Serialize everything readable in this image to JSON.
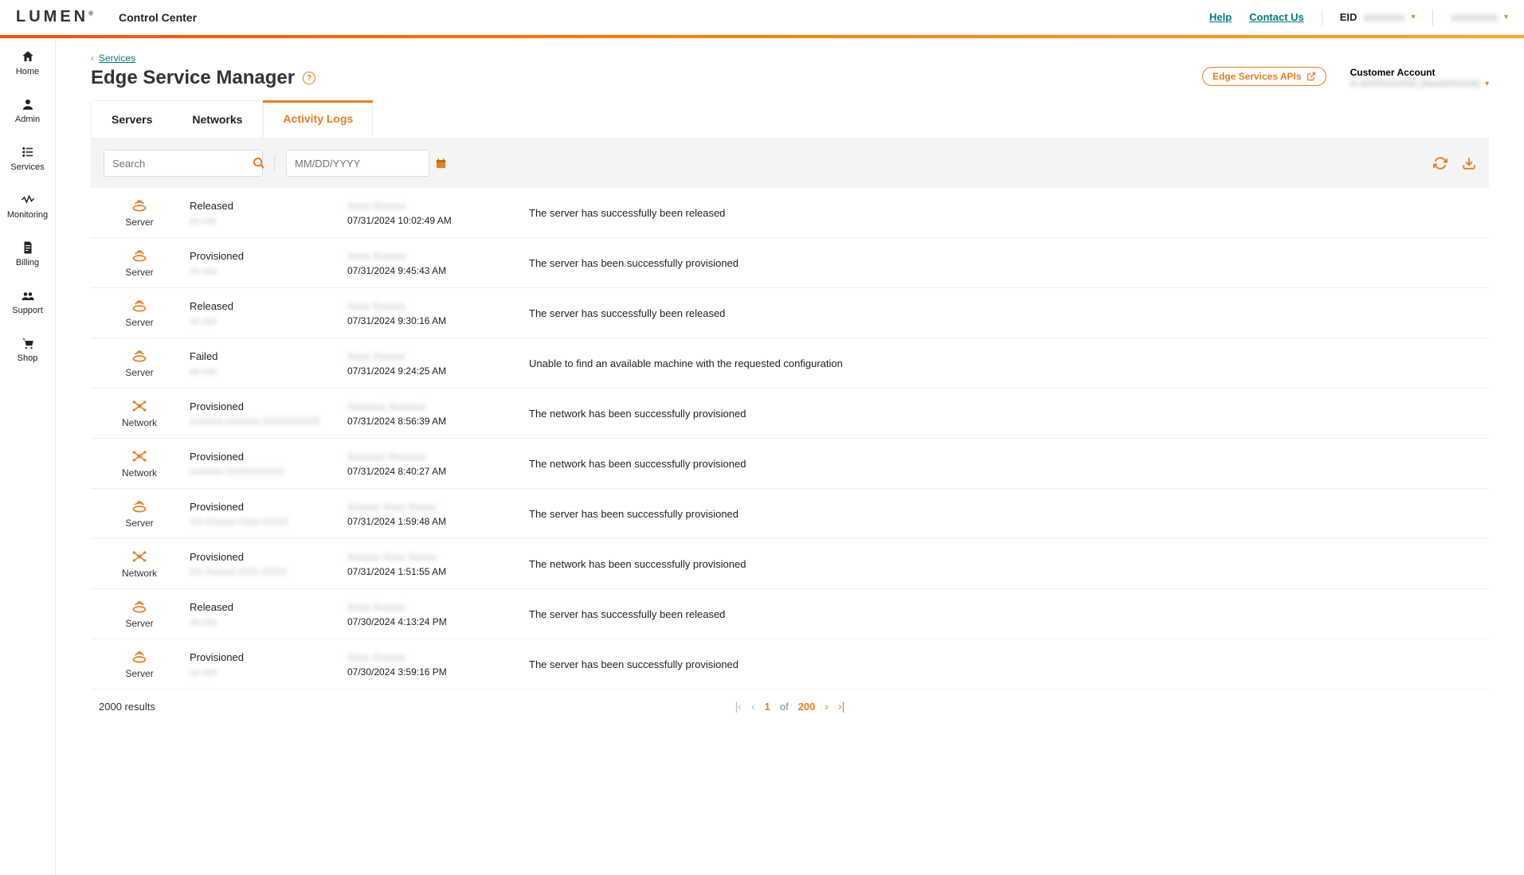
{
  "topbar": {
    "logo": "LUMEN",
    "app_name": "Control Center",
    "help": "Help",
    "contact": "Contact Us",
    "eid_label": "EID",
    "eid_value": "xxxxxxxx",
    "user_value": "xxxxxxxxx"
  },
  "sidenav": [
    {
      "key": "home",
      "label": "Home"
    },
    {
      "key": "admin",
      "label": "Admin"
    },
    {
      "key": "services",
      "label": "Services"
    },
    {
      "key": "monitoring",
      "label": "Monitoring"
    },
    {
      "key": "billing",
      "label": "Billing"
    },
    {
      "key": "support",
      "label": "Support"
    },
    {
      "key": "shop",
      "label": "Shop"
    }
  ],
  "breadcrumb": {
    "parent": "Services"
  },
  "page": {
    "title": "Edge Service Manager",
    "api_button": "Edge Services APIs",
    "account_label": "Customer Account",
    "account_value": "X-XXXXXXXXX (XxxXXXXXX)"
  },
  "tabs": [
    {
      "key": "servers",
      "label": "Servers",
      "active": false
    },
    {
      "key": "networks",
      "label": "Networks",
      "active": false
    },
    {
      "key": "activity",
      "label": "Activity Logs",
      "active": true
    }
  ],
  "filters": {
    "search_placeholder": "Search",
    "date_placeholder": "MM/DD/YYYY"
  },
  "logs": [
    {
      "type": "Server",
      "status": "Released",
      "sub": "xx-xxx",
      "user": "Xxxx Xxxxxx",
      "datetime": "07/31/2024 10:02:49 AM",
      "message": "The server has successfully been released"
    },
    {
      "type": "Server",
      "status": "Provisioned",
      "sub": "xx-xxx",
      "user": "Xxxx Xxxxxx",
      "datetime": "07/31/2024 9:45:43 AM",
      "message": "The server has been successfully provisioned"
    },
    {
      "type": "Server",
      "status": "Released",
      "sub": "xx-xxx",
      "user": "Xxxx Xxxxxx",
      "datetime": "07/31/2024 9:30:16 AM",
      "message": "The server has successfully been released"
    },
    {
      "type": "Server",
      "status": "Failed",
      "sub": "xx-xxx",
      "user": "Xxxx Xxxxxx",
      "datetime": "07/31/2024 9:24:25 AM",
      "message": "Unable to find an available machine with the requested configuration"
    },
    {
      "type": "Network",
      "status": "Provisioned",
      "sub": "xxxxxxx-xxxxxxx-XXXXXXXXX",
      "user": "Xxxxxxx Xxxxxxx",
      "datetime": "07/31/2024 8:56:39 AM",
      "message": "The network has been successfully provisioned"
    },
    {
      "type": "Network",
      "status": "Provisioned",
      "sub": "xxxxxxx-XXXXXXXXX",
      "user": "Xxxxxxx Xxxxxxx",
      "datetime": "07/31/2024 8:40:27 AM",
      "message": "The network has been successfully provisioned"
    },
    {
      "type": "Server",
      "status": "Provisioned",
      "sub": "XX-Xxxxxx-Xxxx-XXXX",
      "user": "Xxxxxx Xxxx Xxxxx",
      "datetime": "07/31/2024 1:59:48 AM",
      "message": "The server has been successfully provisioned"
    },
    {
      "type": "Network",
      "status": "Provisioned",
      "sub": "XX-Xxxxxx-XXX-XXXX",
      "user": "Xxxxxx Xxxx Xxxxx",
      "datetime": "07/31/2024 1:51:55 AM",
      "message": "The network has been successfully provisioned"
    },
    {
      "type": "Server",
      "status": "Released",
      "sub": "xx-xxx",
      "user": "Xxxx Xxxxxx",
      "datetime": "07/30/2024 4:13:24 PM",
      "message": "The server has successfully been released"
    },
    {
      "type": "Server",
      "status": "Provisioned",
      "sub": "xx-xxx",
      "user": "Xxxx Xxxxxx",
      "datetime": "07/30/2024 3:59:16 PM",
      "message": "The server has been successfully provisioned"
    }
  ],
  "pagination": {
    "results_text": "2000 results",
    "current_page": "1",
    "of_label": "of",
    "total_pages": "200"
  }
}
